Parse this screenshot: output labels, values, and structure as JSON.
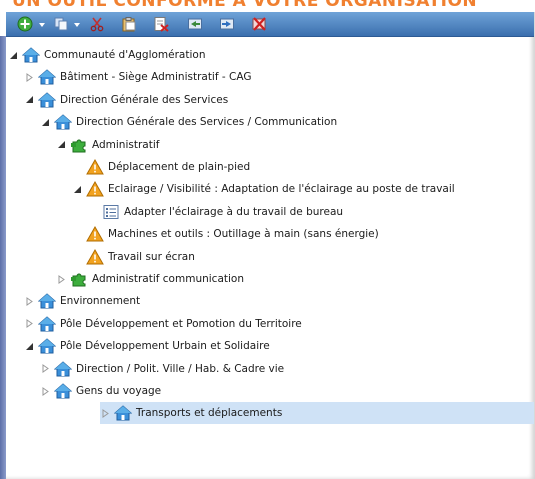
{
  "banner": {
    "text": "UN OUTIL CONFORME A VOTRE ORGANISATION"
  },
  "toolbar": {
    "buttons": [
      "add-icon",
      "copy-icon",
      "cut-icon",
      "paste-icon",
      "delete-document-icon",
      "import-icon",
      "export-icon",
      "remove-icon"
    ]
  },
  "tree": [
    {
      "label": "Communauté d'Agglomération",
      "type": "house",
      "state": "expanded",
      "level": 0
    },
    {
      "label": "Bâtiment - Siège Administratif - CAG",
      "type": "house",
      "state": "collapsed",
      "level": 1
    },
    {
      "label": "Direction Générale des Services",
      "type": "house",
      "state": "expanded",
      "level": 1
    },
    {
      "label": "Direction Générale des Services / Communication",
      "type": "house",
      "state": "expanded",
      "level": 2
    },
    {
      "label": "Administratif",
      "type": "puzzle",
      "state": "expanded",
      "level": 3
    },
    {
      "label": "Déplacement de plain-pied",
      "type": "warning",
      "state": "none",
      "level": 4
    },
    {
      "label": "Eclairage / Visibilité : Adaptation de l'éclairage au poste de travail",
      "type": "warning",
      "state": "expanded",
      "level": 4
    },
    {
      "label": "Adapter l'éclairage à du travail de bureau",
      "type": "list",
      "state": "none",
      "level": 5
    },
    {
      "label": "Machines et outils : Outillage à main (sans énergie)",
      "type": "warning",
      "state": "none",
      "level": 4
    },
    {
      "label": "Travail sur écran",
      "type": "warning",
      "state": "none",
      "level": 4
    },
    {
      "label": "Administratif communication",
      "type": "puzzle",
      "state": "collapsed",
      "level": 3
    },
    {
      "label": "Environnement",
      "type": "house",
      "state": "collapsed",
      "level": 1
    },
    {
      "label": "Pôle Développement et Pomotion du Territoire",
      "type": "house",
      "state": "collapsed",
      "level": 1
    },
    {
      "label": "Pôle Développement Urbain et Solidaire",
      "type": "house",
      "state": "expanded",
      "level": 1
    },
    {
      "label": "Direction / Polit. Ville / Hab. & Cadre vie",
      "type": "house",
      "state": "collapsed",
      "level": 2
    },
    {
      "label": "Gens du voyage",
      "type": "house",
      "state": "collapsed",
      "level": 2
    },
    {
      "label": "Transports et déplacements",
      "type": "house",
      "state": "collapsed",
      "level": 2,
      "selected": true
    }
  ]
}
